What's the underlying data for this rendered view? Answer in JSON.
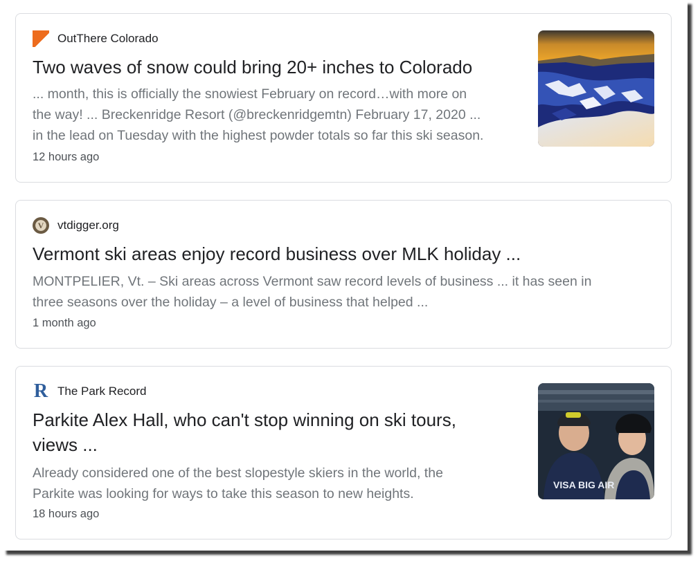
{
  "results": [
    {
      "source": "OutThere Colorado",
      "source_icon": "outthere-colorado-logo-icon",
      "headline": "Two waves of snow could bring 20+ inches to Colorado",
      "snippet_lines": [
        "... month, this is officially the snowiest February on record…with more on",
        "the way! ... Breckenridge Resort (@breckenridgemtn) February 17, 2020 ...",
        "in the lead on Tuesday with the highest powder totals so far this ski season."
      ],
      "time": "12 hours ago",
      "thumbnail": "snowy-mountain-sunset-image"
    },
    {
      "source": "vtdigger.org",
      "source_icon": "vtdigger-logo-icon",
      "source_icon_glyph": "V",
      "headline": "Vermont ski areas enjoy record business over MLK holiday ...",
      "snippet_lines": [
        "MONTPELIER, Vt. – Ski areas across Vermont saw record levels of business ... it has seen in",
        "three seasons over the holiday – a level of business that helped ..."
      ],
      "time": "1 month ago"
    },
    {
      "source": "The Park Record",
      "source_icon": "park-record-logo-icon",
      "source_icon_glyph": "R",
      "headline_lines": [
        "Parkite Alex Hall, who can't stop winning on ski tours,",
        "views ..."
      ],
      "snippet_lines": [
        "Already considered one of the best slopestyle skiers in the world, the",
        "Parkite was looking for ways to take this season to new heights."
      ],
      "time": "18 hours ago",
      "thumbnail": "skiers-smiling-photo",
      "thumbnail_text": "VISA BIG AIR"
    }
  ],
  "colors": {
    "headline": "#202124",
    "snippet": "#70757a",
    "time": "#4d5156",
    "card_border": "#dadce0",
    "outthere_orange": "#ed6c1e",
    "park_record_blue": "#2f5e9c"
  }
}
